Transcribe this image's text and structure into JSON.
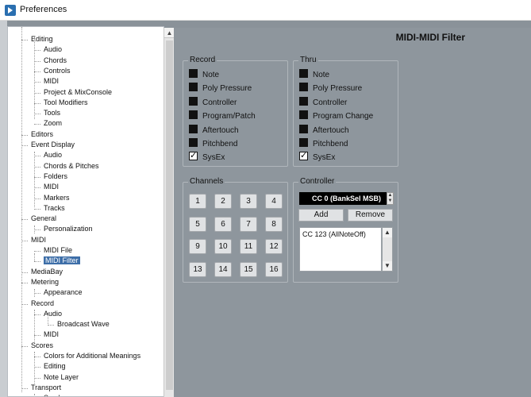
{
  "window": {
    "title": "Preferences"
  },
  "scrollbar": {
    "up_arrow": "▲"
  },
  "tree": {
    "items": [
      {
        "label": "Editing",
        "level": 0
      },
      {
        "label": "Audio",
        "level": 1
      },
      {
        "label": "Chords",
        "level": 1
      },
      {
        "label": "Controls",
        "level": 1
      },
      {
        "label": "MIDI",
        "level": 1
      },
      {
        "label": "Project & MixConsole",
        "level": 1
      },
      {
        "label": "Tool Modifiers",
        "level": 1
      },
      {
        "label": "Tools",
        "level": 1
      },
      {
        "label": "Zoom",
        "level": 1
      },
      {
        "label": "Editors",
        "level": 0
      },
      {
        "label": "Event Display",
        "level": 0
      },
      {
        "label": "Audio",
        "level": 1
      },
      {
        "label": "Chords & Pitches",
        "level": 1
      },
      {
        "label": "Folders",
        "level": 1
      },
      {
        "label": "MIDI",
        "level": 1
      },
      {
        "label": "Markers",
        "level": 1
      },
      {
        "label": "Tracks",
        "level": 1
      },
      {
        "label": "General",
        "level": 0
      },
      {
        "label": "Personalization",
        "level": 1
      },
      {
        "label": "MIDI",
        "level": 0
      },
      {
        "label": "MIDI File",
        "level": 1
      },
      {
        "label": "MIDI Filter",
        "level": 1,
        "selected": true
      },
      {
        "label": "MediaBay",
        "level": 0
      },
      {
        "label": "Metering",
        "level": 0
      },
      {
        "label": "Appearance",
        "level": 1
      },
      {
        "label": "Record",
        "level": 0
      },
      {
        "label": "Audio",
        "level": 1
      },
      {
        "label": "Broadcast Wave",
        "level": 2
      },
      {
        "label": "MIDI",
        "level": 1
      },
      {
        "label": "Scores",
        "level": 0
      },
      {
        "label": "Colors for Additional Meanings",
        "level": 1
      },
      {
        "label": "Editing",
        "level": 1
      },
      {
        "label": "Note Layer",
        "level": 1
      },
      {
        "label": "Transport",
        "level": 0
      },
      {
        "label": "Scrub",
        "level": 1
      }
    ]
  },
  "page": {
    "title": "MIDI-MIDI Filter"
  },
  "record": {
    "title": "Record",
    "items": [
      {
        "label": "Note",
        "checked": false
      },
      {
        "label": "Poly Pressure",
        "checked": false
      },
      {
        "label": "Controller",
        "checked": false
      },
      {
        "label": "Program/Patch",
        "checked": false
      },
      {
        "label": "Aftertouch",
        "checked": false
      },
      {
        "label": "Pitchbend",
        "checked": false
      },
      {
        "label": "SysEx",
        "checked": true
      }
    ]
  },
  "thru": {
    "title": "Thru",
    "items": [
      {
        "label": "Note",
        "checked": false
      },
      {
        "label": "Poly Pressure",
        "checked": false
      },
      {
        "label": "Controller",
        "checked": false
      },
      {
        "label": "Program Change",
        "checked": false
      },
      {
        "label": "Aftertouch",
        "checked": false
      },
      {
        "label": "Pitchbend",
        "checked": false
      },
      {
        "label": "SysEx",
        "checked": true
      }
    ]
  },
  "channels": {
    "title": "Channels",
    "buttons": [
      "1",
      "2",
      "3",
      "4",
      "5",
      "6",
      "7",
      "8",
      "9",
      "10",
      "11",
      "12",
      "13",
      "14",
      "15",
      "16"
    ]
  },
  "controller": {
    "title": "Controller",
    "selected": "CC 0  (BankSel MSB)",
    "add_label": "Add",
    "remove_label": "Remove",
    "list": [
      "CC 123  (AllNoteOff)"
    ],
    "spin_up": "▲",
    "spin_down": "▼"
  }
}
